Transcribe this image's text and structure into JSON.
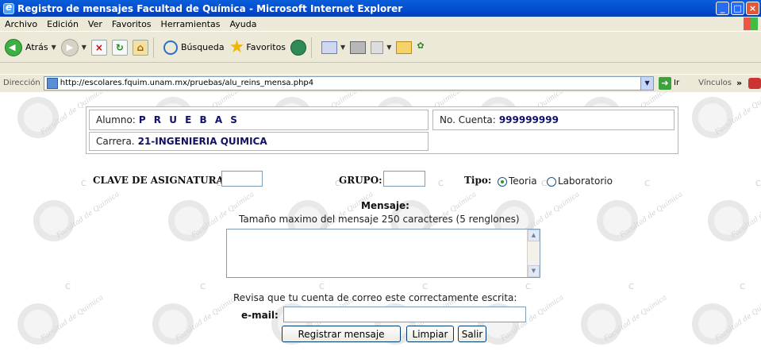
{
  "window": {
    "title": "Registro de mensajes Facultad de Química - Microsoft Internet Explorer"
  },
  "menu": [
    "Archivo",
    "Edición",
    "Ver",
    "Favoritos",
    "Herramientas",
    "Ayuda"
  ],
  "toolbar": {
    "back_label": "Atrás",
    "search_label": "Búsqueda",
    "favorites_label": "Favoritos"
  },
  "address": {
    "label": "Dirección",
    "url": "http://escolares.fquim.unam.mx/pruebas/alu_reins_mensa.php4",
    "go_label": "Ir",
    "links_label": "Vínculos"
  },
  "watermark": {
    "text": "Facultad de Química"
  },
  "student": {
    "alumno_label": "Alumno:",
    "alumno_value": "P R U E B A S",
    "cuenta_label": "No. Cuenta:",
    "cuenta_value": "999999999",
    "carrera_label": "Carrera.",
    "carrera_value": "21-INGENIERIA QUIMICA"
  },
  "form": {
    "clave_label": "CLAVE DE ASIGNATURA:",
    "grupo_label": "GRUPO:",
    "tipo_label": "Tipo:",
    "tipo_options": [
      "Teoria",
      "Laboratorio"
    ],
    "tipo_selected": "Teoria",
    "mensaje_label": "Mensaje:",
    "mensaje_hint": "Tamaño maximo del mensaje 250 caracteres (5 renglones)",
    "email_hint": "Revisa que tu cuenta de correo este correctamente escrita:",
    "email_label": "e-mail:",
    "submit_label": "Registrar mensaje",
    "clear_label": "Limpiar",
    "exit_label": "Salir"
  }
}
